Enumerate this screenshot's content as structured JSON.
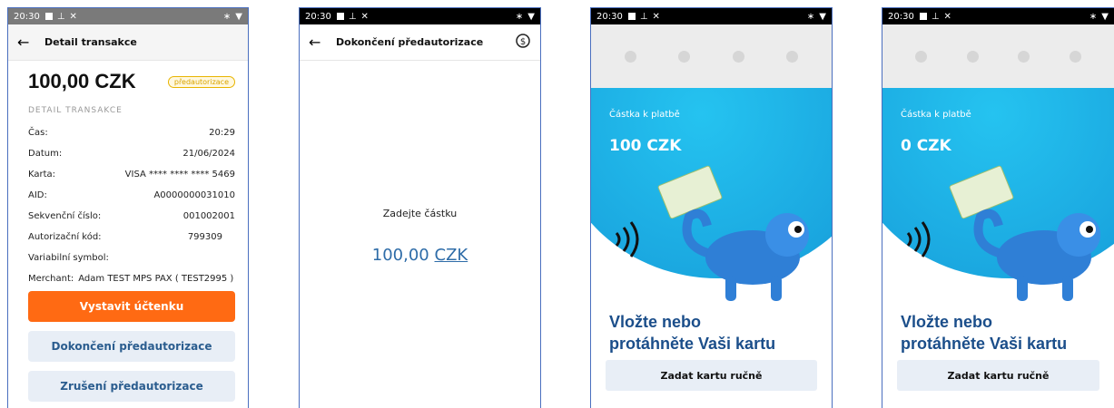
{
  "status": {
    "time": "20:30",
    "time_p1": "20:30"
  },
  "detail": {
    "title": "Detail transakce",
    "amount": "100,00 CZK",
    "badge": "předautorizace",
    "section": "DETAIL TRANSAKCE",
    "rows": [
      {
        "k": "Čas:",
        "v": "20:29"
      },
      {
        "k": "Datum:",
        "v": "21/06/2024"
      },
      {
        "k": "Karta:",
        "v": "VISA **** **** **** 5469"
      },
      {
        "k": "AID:",
        "v": "A0000000031010"
      },
      {
        "k": "Sekvenční číslo:",
        "v": "001002001"
      },
      {
        "k": "Autorizační kód:",
        "v": "799309"
      },
      {
        "k": "Variabilní symbol:",
        "v": ""
      },
      {
        "k": "Merchant:",
        "v": "Adam TEST MPS PAX ( TEST2995 )"
      }
    ],
    "btn_receipt": "Vystavit účtenku",
    "btn_complete": "Dokončení předautorizace",
    "btn_cancel": "Zrušení předautorizace"
  },
  "completion": {
    "title": "Dokončení předautorizace",
    "prompt": "Zadejte částku",
    "amount_value": "100,00",
    "amount_currency": "CZK"
  },
  "pay1": {
    "label": "Částka k platbě",
    "amount": "100 CZK",
    "cta_line1": "Vložte nebo",
    "cta_line2": "protáhněte Vaši kartu",
    "manual": "Zadat kartu ručně"
  },
  "pay2": {
    "label": "Částka k platbě",
    "amount": "0 CZK",
    "cta_line1": "Vložte nebo",
    "cta_line2": "protáhněte Vaši kartu",
    "manual": "Zadat kartu ručně"
  },
  "colors": {
    "accent_orange": "#ff6a13",
    "brand_blue": "#1b4e8a",
    "hero_cyan": "#1aa6df",
    "badge_yellow": "#e8b400"
  }
}
